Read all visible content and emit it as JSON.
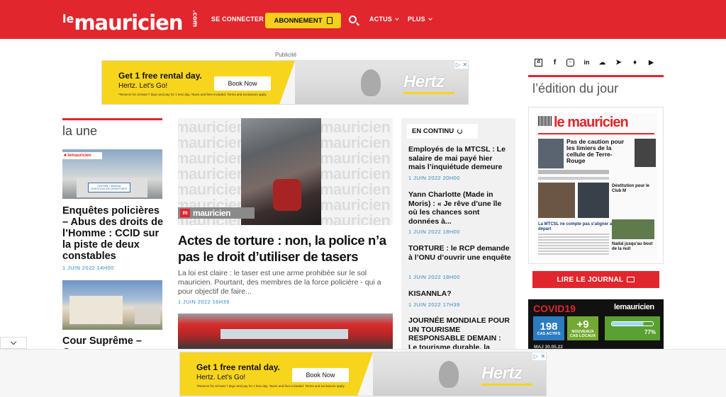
{
  "header": {
    "logo_le": "le",
    "logo_main": "mauricien",
    "logo_dotcom": ".com",
    "se_connecter": "SE CONNECTER",
    "abonnement": "ABONNEMENT",
    "actus": "ACTUS",
    "plus": "PLUS"
  },
  "ad_top": {
    "label": "Publicité",
    "headline": "Get 1 free rental day.",
    "sub": "Hertz. Let's Go!",
    "fine": "*Reserve for at least 7 days and pay for 1 less day. Taxes and fees included. Terms and exclusions apply.",
    "button": "Book Now",
    "brand": "Hertz"
  },
  "la_une": {
    "title": "la une",
    "items": [
      {
        "headline": "Enquêtes policières – Abus des droits de l’Homme : CCID sur la piste de deux constables",
        "date": "1 JUIN 2022 14H00",
        "sign": "CENTRAL CRIMINAL INVESTIGATION DEPARTMENT"
      },
      {
        "headline": "Cour Suprême – Oc...",
        "date": ""
      }
    ]
  },
  "main_article": {
    "title": "Actes de torture : non, la police n’a pas le droit d’utiliser de tasers",
    "excerpt": "La loi est claire : le taser est une arme prohibée sur le sol mauricien. Pourtant, des membres de la force policière - qui a pour objectif de faire...",
    "date": "1 JUIN 2022 16H39",
    "watermark": "mauricien"
  },
  "en_continu": {
    "title": "EN CONTINU",
    "items": [
      {
        "title": "Employés de la MTCSL : Le salaire de mai payé hier mais l’inquiétude demeure",
        "date": "1 JUIN 2022 20H00"
      },
      {
        "title": "Yann Charlotte (Made in Moris) : « Je rêve d’une île où les chances sont données à...",
        "date": "1 JUIN 2022 18H00"
      },
      {
        "title": "TORTURE : le RCP demande à l’ONU d’ouvrir une enquête",
        "date": "1 JUIN 2022 18H00"
      },
      {
        "title": "KISANNLA?",
        "date": "1 JUIN 2022 17H39"
      },
      {
        "title": "JOURNÉE MONDIALE POUR UN TOURISME RESPONSABLE DEMAIN : Le tourisme durable, la",
        "date": ""
      }
    ]
  },
  "sidebar": {
    "social_icons": [
      "dailymotion-icon",
      "facebook-icon",
      "instagram-icon",
      "linkedin-icon",
      "soundcloud-icon",
      "telegram-icon",
      "twitter-icon",
      "youtube-icon"
    ],
    "edition_title": "l’édition du jour",
    "paper": {
      "masthead": "le mauricien",
      "headline": "Pas de caution pour les limiers de la cellule de Terre-Rouge",
      "sub1": "La MTCSL ne compte pas s’aligner au départ",
      "sub2": "Déstitution pour le Club M",
      "sub3": "Nadal jusqu’au bout de la nuit"
    },
    "lire_button": "LIRE LE JOURNAL",
    "covid": {
      "title": "COVID19",
      "logo": "lemauricien",
      "actifs_value": "198",
      "actifs_label": "CAS ACTIFS",
      "locaux_value": "+9",
      "locaux_label": "NOUVEAUX CAS LOCAUX",
      "vaccin_pct": "77%",
      "date": "MAJ 30.05.22"
    }
  },
  "ad_bottom": {
    "headline": "Get 1 free rental day.",
    "sub": "Hertz. Let's Go!",
    "fine": "*Reserve for at least 7 days and pay for 1 less day. Taxes and fees included. Terms and exclusions apply.",
    "button": "Book Now",
    "brand": "Hertz"
  },
  "colors": {
    "brand_red": "#e1262d",
    "abonnement_yellow": "#f5cf1c",
    "date_blue": "#2f8abf",
    "ad_yellow": "#f7d51d"
  }
}
